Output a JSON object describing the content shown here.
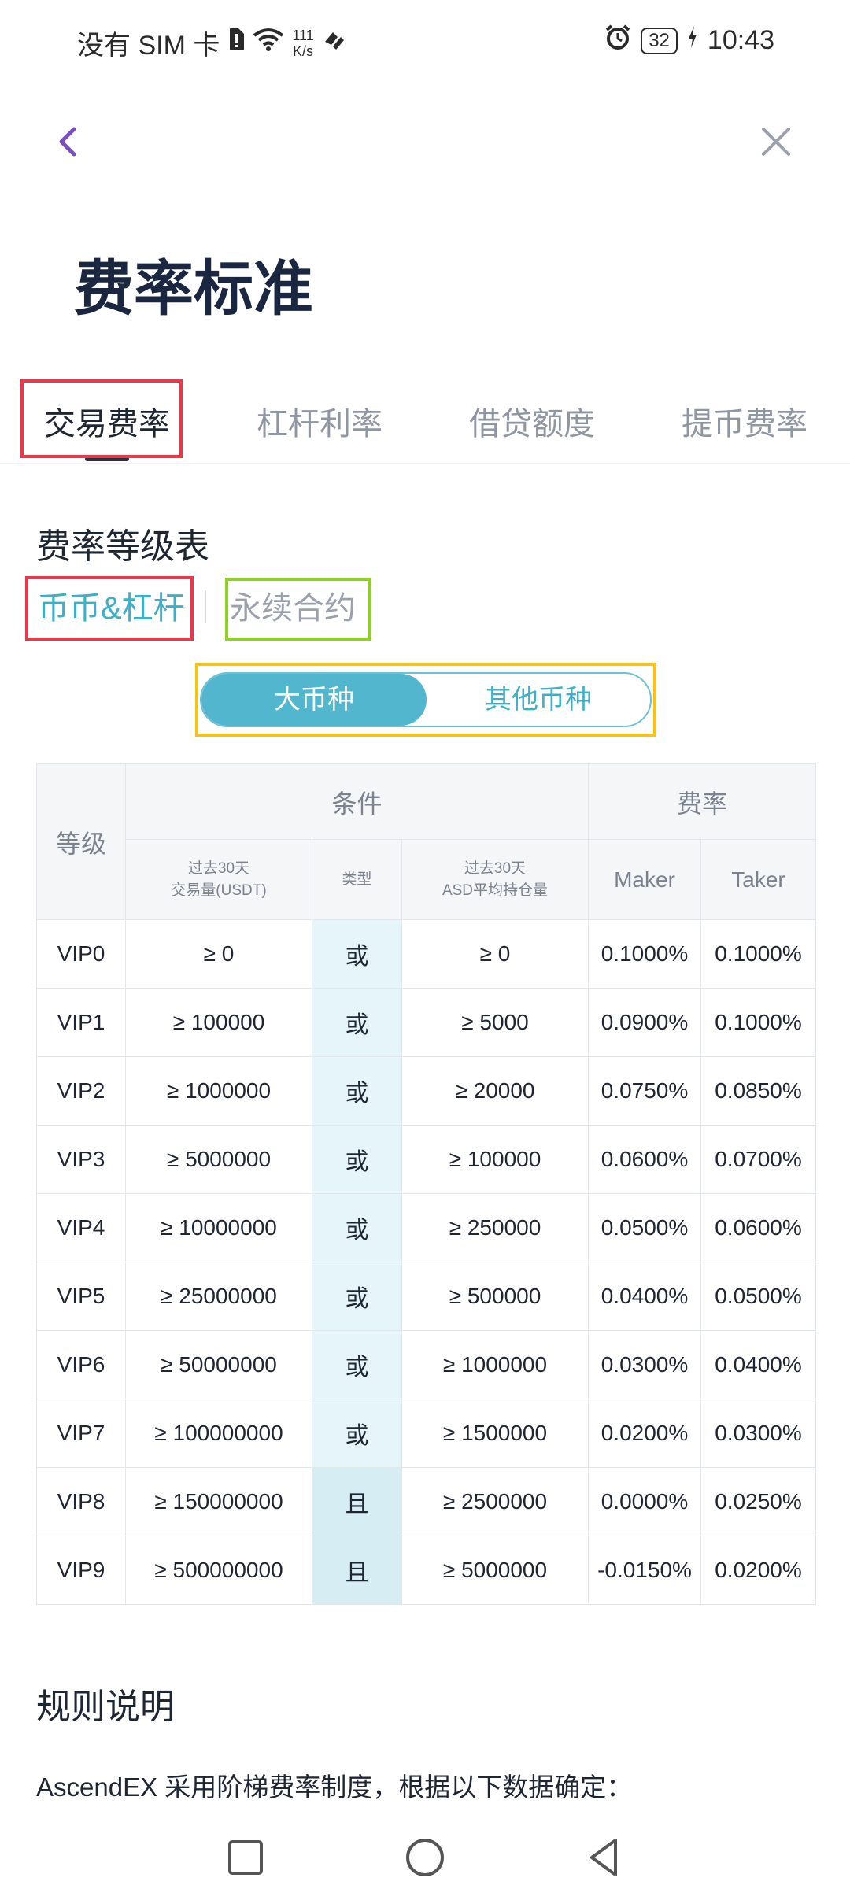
{
  "status_bar": {
    "carrier": "没有 SIM 卡",
    "speed_value": "111",
    "speed_unit": "K/s",
    "battery": "32",
    "time": "10:43"
  },
  "header": {
    "title": "费率标准"
  },
  "tabs": [
    {
      "label": "交易费率",
      "active": true
    },
    {
      "label": "杠杆利率",
      "active": false
    },
    {
      "label": "借贷额度",
      "active": false
    },
    {
      "label": "提币费率",
      "active": false
    }
  ],
  "section": {
    "title": "费率等级表",
    "sub_tabs": [
      {
        "label": "币币&杠杆",
        "active": true
      },
      {
        "label": "永续合约",
        "active": false
      }
    ],
    "segment": [
      {
        "label": "大币种",
        "active": true
      },
      {
        "label": "其他币种",
        "active": false
      }
    ]
  },
  "table": {
    "head": {
      "level": "等级",
      "conditions": "条件",
      "fee_rate": "费率",
      "volume_line1": "过去30天",
      "volume_line2": "交易量(USDT)",
      "type": "类型",
      "holding_line1": "过去30天",
      "holding_line2": "ASD平均持仓量",
      "maker": "Maker",
      "taker": "Taker"
    },
    "rows": [
      {
        "level": "VIP0",
        "volume": "≥ 0",
        "type": "或",
        "holding": "≥ 0",
        "maker": "0.1000%",
        "taker": "0.1000%"
      },
      {
        "level": "VIP1",
        "volume": "≥ 100000",
        "type": "或",
        "holding": "≥ 5000",
        "maker": "0.0900%",
        "taker": "0.1000%"
      },
      {
        "level": "VIP2",
        "volume": "≥ 1000000",
        "type": "或",
        "holding": "≥ 20000",
        "maker": "0.0750%",
        "taker": "0.0850%"
      },
      {
        "level": "VIP3",
        "volume": "≥ 5000000",
        "type": "或",
        "holding": "≥ 100000",
        "maker": "0.0600%",
        "taker": "0.0700%"
      },
      {
        "level": "VIP4",
        "volume": "≥ 10000000",
        "type": "或",
        "holding": "≥ 250000",
        "maker": "0.0500%",
        "taker": "0.0600%"
      },
      {
        "level": "VIP5",
        "volume": "≥ 25000000",
        "type": "或",
        "holding": "≥ 500000",
        "maker": "0.0400%",
        "taker": "0.0500%"
      },
      {
        "level": "VIP6",
        "volume": "≥ 50000000",
        "type": "或",
        "holding": "≥ 1000000",
        "maker": "0.0300%",
        "taker": "0.0400%"
      },
      {
        "level": "VIP7",
        "volume": "≥ 100000000",
        "type": "或",
        "holding": "≥ 1500000",
        "maker": "0.0200%",
        "taker": "0.0300%"
      },
      {
        "level": "VIP8",
        "volume": "≥ 150000000",
        "type": "且",
        "holding": "≥ 2500000",
        "maker": "0.0000%",
        "taker": "0.0250%"
      },
      {
        "level": "VIP9",
        "volume": "≥ 500000000",
        "type": "且",
        "holding": "≥ 5000000",
        "maker": "-0.0150%",
        "taker": "0.0200%"
      }
    ]
  },
  "rules": {
    "title": "规则说明",
    "text": "AscendEX 采用阶梯费率制度，根据以下数据确定："
  },
  "colors": {
    "accent": "#52b6cf",
    "title": "#1b2740",
    "back_arrow": "#7b4fc2",
    "highlight_red": "#e8394a",
    "highlight_green": "#8fd11f",
    "highlight_yellow": "#f4c21a"
  },
  "icons": {
    "back": "chevron-left-icon",
    "close": "close-icon",
    "nav_recent": "square-icon",
    "nav_home": "circle-icon",
    "nav_back": "triangle-back-icon"
  }
}
